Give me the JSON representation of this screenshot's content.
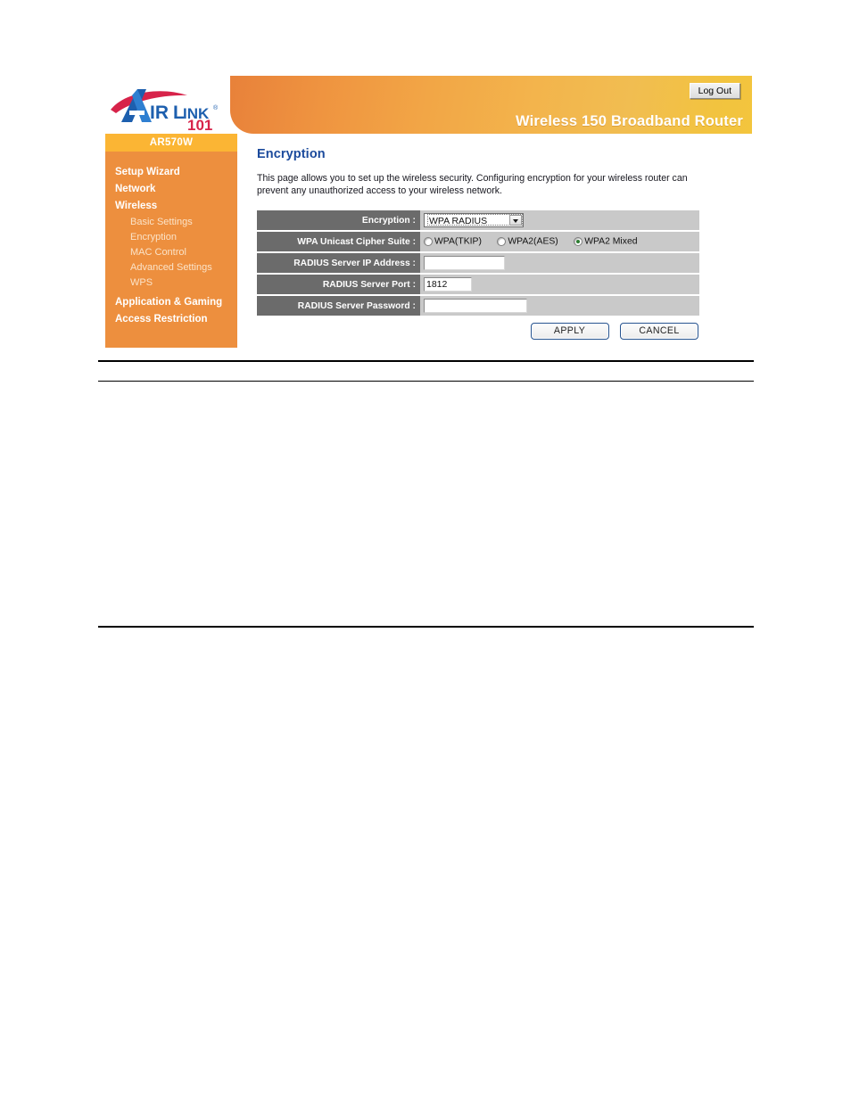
{
  "header": {
    "brand_primary": "AIRLINK",
    "brand_suffix": "101",
    "product_title": "Wireless 150 Broadband Router",
    "logout_label": "Log Out",
    "brand_blue": "#1d5fae",
    "brand_red": "#d7234a",
    "banner_orange": "#ed8f3e",
    "banner_yellow": "#f3c53d"
  },
  "sidebar": {
    "model": "AR570W",
    "items": [
      {
        "label": "Setup Wizard",
        "type": "top"
      },
      {
        "label": "Network",
        "type": "top"
      },
      {
        "label": "Wireless",
        "type": "top"
      },
      {
        "label": "Basic Settings",
        "type": "sub"
      },
      {
        "label": "Encryption",
        "type": "sub",
        "active": true
      },
      {
        "label": "MAC Control",
        "type": "sub"
      },
      {
        "label": "Advanced Settings",
        "type": "sub"
      },
      {
        "label": "WPS",
        "type": "sub"
      },
      {
        "label": "Application & Gaming",
        "type": "top"
      },
      {
        "label": "Access Restriction",
        "type": "top"
      }
    ]
  },
  "content": {
    "title": "Encryption",
    "description": "This page allows you to set up the wireless security. Configuring encryption for your wireless router can prevent any unauthorized access to your wireless network.",
    "rows": {
      "encryption": {
        "label": "Encryption :",
        "selected": "WPA RADIUS"
      },
      "cipher_suite": {
        "label": "WPA Unicast Cipher Suite :",
        "options": [
          {
            "label": "WPA(TKIP)",
            "checked": false
          },
          {
            "label": "WPA2(AES)",
            "checked": false
          },
          {
            "label": "WPA2 Mixed",
            "checked": true
          }
        ]
      },
      "radius_ip": {
        "label": "RADIUS Server IP Address :",
        "value": ""
      },
      "radius_port": {
        "label": "RADIUS Server Port :",
        "value": "1812"
      },
      "radius_password": {
        "label": "RADIUS Server Password :",
        "value": ""
      }
    },
    "buttons": {
      "apply": "APPLY",
      "cancel": "CANCEL"
    }
  }
}
